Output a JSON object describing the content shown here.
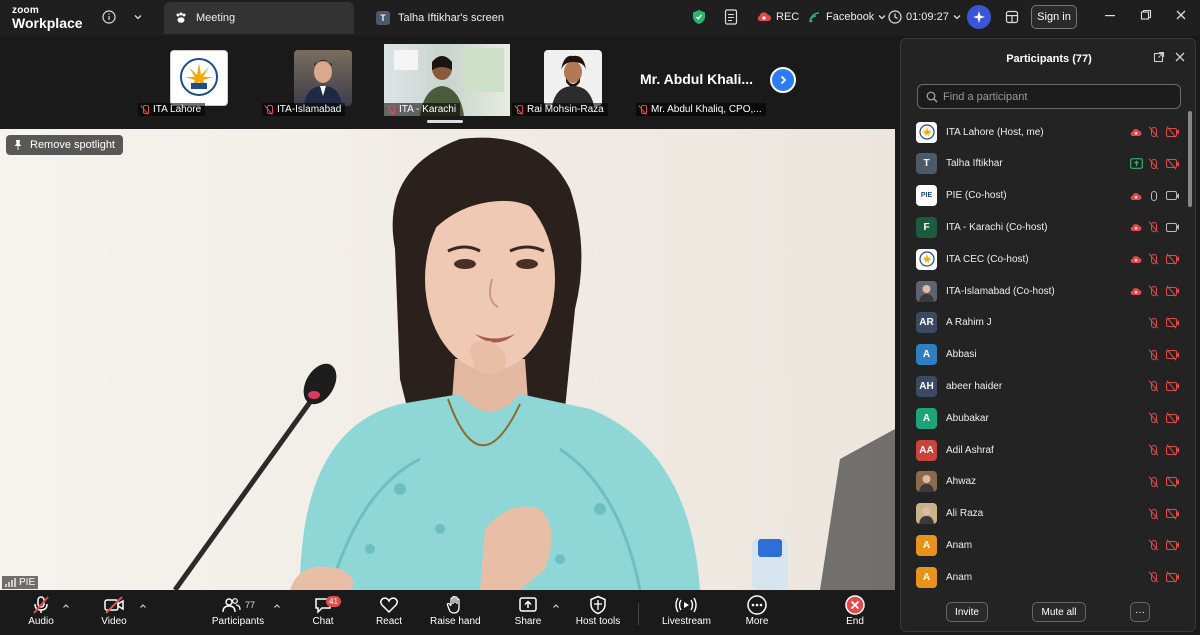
{
  "app": {
    "brand_line1": "zoom",
    "brand_line2": "Workplace"
  },
  "tabs": [
    {
      "label": "Meeting"
    },
    {
      "label": "Talha Iftikhar's screen",
      "initial": "T"
    }
  ],
  "topbar": {
    "rec_label": "REC",
    "stream_label": "Facebook",
    "timer": "01:09:27",
    "signin_label": "Sign in"
  },
  "thumbnails": [
    {
      "name": "ITA Lahore"
    },
    {
      "name": "ITA-Islamabad"
    },
    {
      "name": "ITA - Karachi"
    },
    {
      "name": "Rai Mohsin-Raza"
    },
    {
      "name": "Mr. Abdul Khaliq, CPO,...",
      "big_text": "Mr. Abdul Khali..."
    }
  ],
  "video": {
    "spotlight_label": "Remove spotlight",
    "speaker_label": "PIE"
  },
  "toolbar": {
    "audio": "Audio",
    "video": "Video",
    "participants": "Participants",
    "participants_count": "77",
    "chat": "Chat",
    "chat_badge": "41",
    "react": "React",
    "raise_hand": "Raise hand",
    "share": "Share",
    "host_tools": "Host tools",
    "livestream": "Livestream",
    "more": "More",
    "end": "End"
  },
  "panel": {
    "title": "Participants (77)",
    "search_placeholder": "Find a participant",
    "invite_label": "Invite",
    "mute_all_label": "Mute all",
    "more_label": "···",
    "participants": [
      {
        "name": "ITA Lahore (Host, me)",
        "avatar": "",
        "color": "#ffffff",
        "cloud": true,
        "share": false,
        "mic": "off",
        "video": "off"
      },
      {
        "name": "Talha Iftikhar",
        "avatar": "T",
        "color": "#4a5a6a",
        "cloud": false,
        "share": true,
        "mic": "off",
        "video": "off"
      },
      {
        "name": "PIE (Co-host)",
        "avatar": "PIE",
        "color": "#ffffff",
        "cloud": true,
        "share": false,
        "mic": "on",
        "video": "on"
      },
      {
        "name": "ITA - Karachi (Co-host)",
        "avatar": "F",
        "color": "#1e5a3e",
        "cloud": true,
        "share": false,
        "mic": "off",
        "video": "on"
      },
      {
        "name": "ITA CEC (Co-host)",
        "avatar": "",
        "color": "#ffffff",
        "cloud": true,
        "share": false,
        "mic": "off",
        "video": "off"
      },
      {
        "name": "ITA-Islamabad (Co-host)",
        "avatar": "",
        "color": "#5b6470",
        "cloud": true,
        "share": false,
        "mic": "off",
        "video": "off"
      },
      {
        "name": "A Rahim J",
        "avatar": "AR",
        "color": "#3a4a63",
        "cloud": false,
        "share": false,
        "mic": "off",
        "video": "off"
      },
      {
        "name": "Abbasi",
        "avatar": "A",
        "color": "#2f7fc0",
        "cloud": false,
        "share": false,
        "mic": "off",
        "video": "off"
      },
      {
        "name": "abeer haider",
        "avatar": "AH",
        "color": "#3a4a63",
        "cloud": false,
        "share": false,
        "mic": "off",
        "video": "off"
      },
      {
        "name": "Abubakar",
        "avatar": "A",
        "color": "#1fa37a",
        "cloud": false,
        "share": false,
        "mic": "off",
        "video": "off"
      },
      {
        "name": "Adil Ashraf",
        "avatar": "AA",
        "color": "#c9443a",
        "cloud": false,
        "share": false,
        "mic": "off",
        "video": "off"
      },
      {
        "name": "Ahwaz",
        "avatar": "",
        "color": "#8a6a4a",
        "cloud": false,
        "share": false,
        "mic": "off",
        "video": "off"
      },
      {
        "name": "Ali Raza",
        "avatar": "",
        "color": "#c8b48a",
        "cloud": false,
        "share": false,
        "mic": "off",
        "video": "off"
      },
      {
        "name": "Anam",
        "avatar": "A",
        "color": "#e8921e",
        "cloud": false,
        "share": false,
        "mic": "off",
        "video": "off"
      },
      {
        "name": "Anam",
        "avatar": "A",
        "color": "#e8921e",
        "cloud": false,
        "share": false,
        "mic": "off",
        "video": "off"
      }
    ]
  }
}
